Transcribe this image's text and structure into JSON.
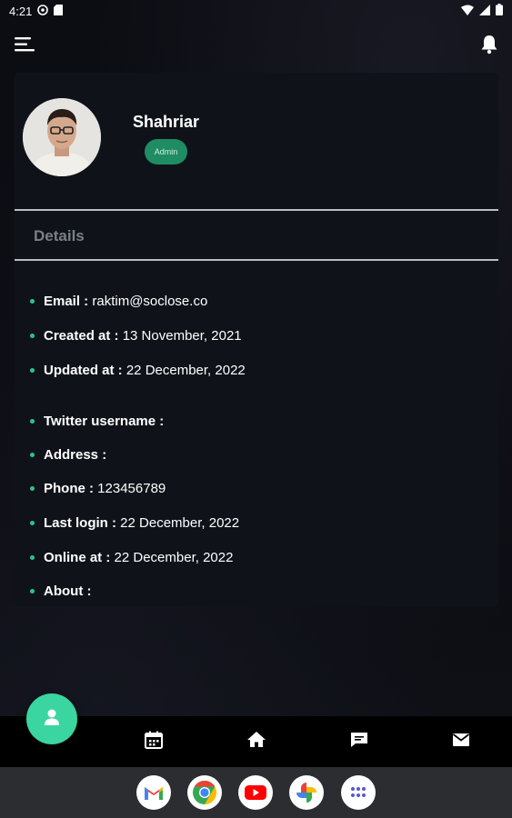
{
  "status_bar": {
    "time": "4:21"
  },
  "profile": {
    "name": "Shahriar",
    "role": "Admin"
  },
  "details": {
    "heading": "Details",
    "items": [
      {
        "label": "Email : ",
        "value": "raktim@soclose.co"
      },
      {
        "label": "Created at : ",
        "value": "13 November, 2021"
      },
      {
        "label": "Updated at : ",
        "value": "22 December, 2022"
      },
      {
        "label": "Twitter username : ",
        "value": ""
      },
      {
        "label": "Address : ",
        "value": ""
      },
      {
        "label": "Phone : ",
        "value": "123456789"
      },
      {
        "label": "Last login : ",
        "value": "22 December, 2022"
      },
      {
        "label": "Online at : ",
        "value": "22 December, 2022"
      },
      {
        "label": "About : ",
        "value": ""
      }
    ]
  },
  "bottom_nav": [
    "calendar-icon",
    "home-icon",
    "chat-icon",
    "mail-icon"
  ],
  "dock": [
    "gmail-icon",
    "chrome-icon",
    "youtube-icon",
    "photos-icon",
    "app-drawer-icon"
  ],
  "colors": {
    "accent": "#3ad5a0",
    "badge": "#1f8c63",
    "card": "#0f1319",
    "background": "#0b0c12"
  }
}
